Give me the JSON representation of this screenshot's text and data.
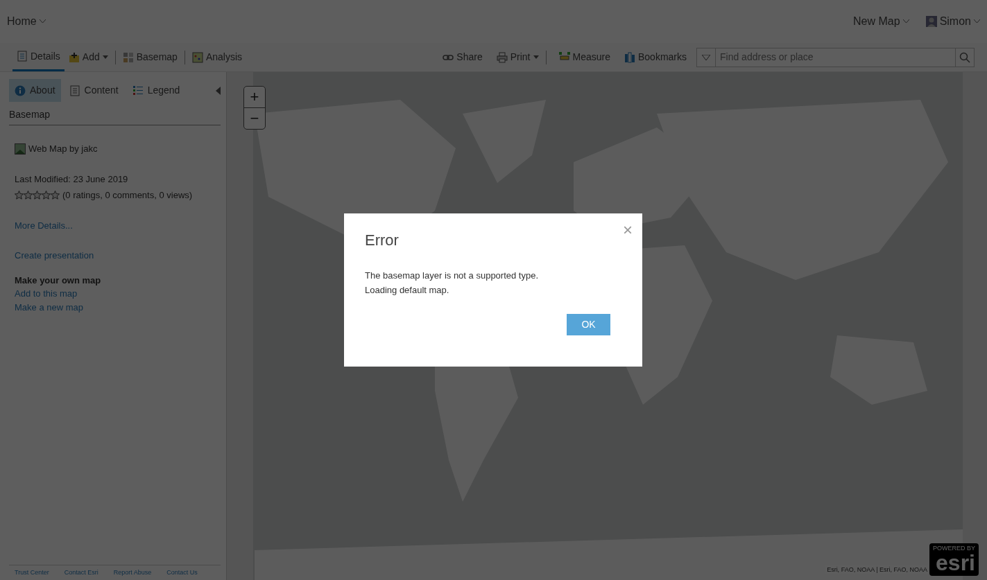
{
  "header": {
    "home": "Home",
    "map_title": "New Map",
    "user": "Simon"
  },
  "toolbar": {
    "left": [
      {
        "label": "Details",
        "kind": "details",
        "selected": true,
        "dropdown": false
      },
      {
        "label": "Add",
        "kind": "add",
        "selected": false,
        "dropdown": true
      },
      {
        "label": "Basemap",
        "kind": "basemap",
        "selected": false,
        "dropdown": false
      },
      {
        "label": "Analysis",
        "kind": "analysis",
        "selected": false,
        "dropdown": false
      }
    ],
    "right": [
      {
        "label": "Share",
        "kind": "share",
        "dropdown": false
      },
      {
        "label": "Print",
        "kind": "print",
        "dropdown": true
      },
      {
        "label": "Measure",
        "kind": "measure",
        "dropdown": false
      },
      {
        "label": "Bookmarks",
        "kind": "bookmarks",
        "dropdown": false
      }
    ],
    "search": {
      "placeholder": "Find address or place"
    }
  },
  "sidebar": {
    "tabs": [
      {
        "label": "About",
        "kind": "about",
        "selected": true
      },
      {
        "label": "Content",
        "kind": "content",
        "selected": false
      },
      {
        "label": "Legend",
        "kind": "legend",
        "selected": false
      }
    ],
    "section_title": "Basemap",
    "item_title": "Web Map by jakc",
    "modified": "Last Modified: 23 June 2019",
    "stars": 0,
    "stats": "(0 ratings, 0 comments, 0 views)",
    "links": [
      "More Details...",
      "Create presentation"
    ],
    "own_map_title": "Make your own map",
    "own_map_links": [
      "Add to this map",
      "Make a new map"
    ],
    "footer_links": [
      "Trust Center",
      "Contact Esri",
      "Report Abuse",
      "Contact Us"
    ]
  },
  "map": {
    "zoom_in": "+",
    "zoom_out": "−",
    "attribution": "Esri, FAO, NOAA | Esri, FAO, NOAA",
    "logo_top": "POWERED BY",
    "logo": "esri"
  },
  "dialog": {
    "title": "Error",
    "close": "×",
    "lines": [
      "The basemap layer is not a supported type.",
      "Loading default map."
    ],
    "button": "OK"
  }
}
